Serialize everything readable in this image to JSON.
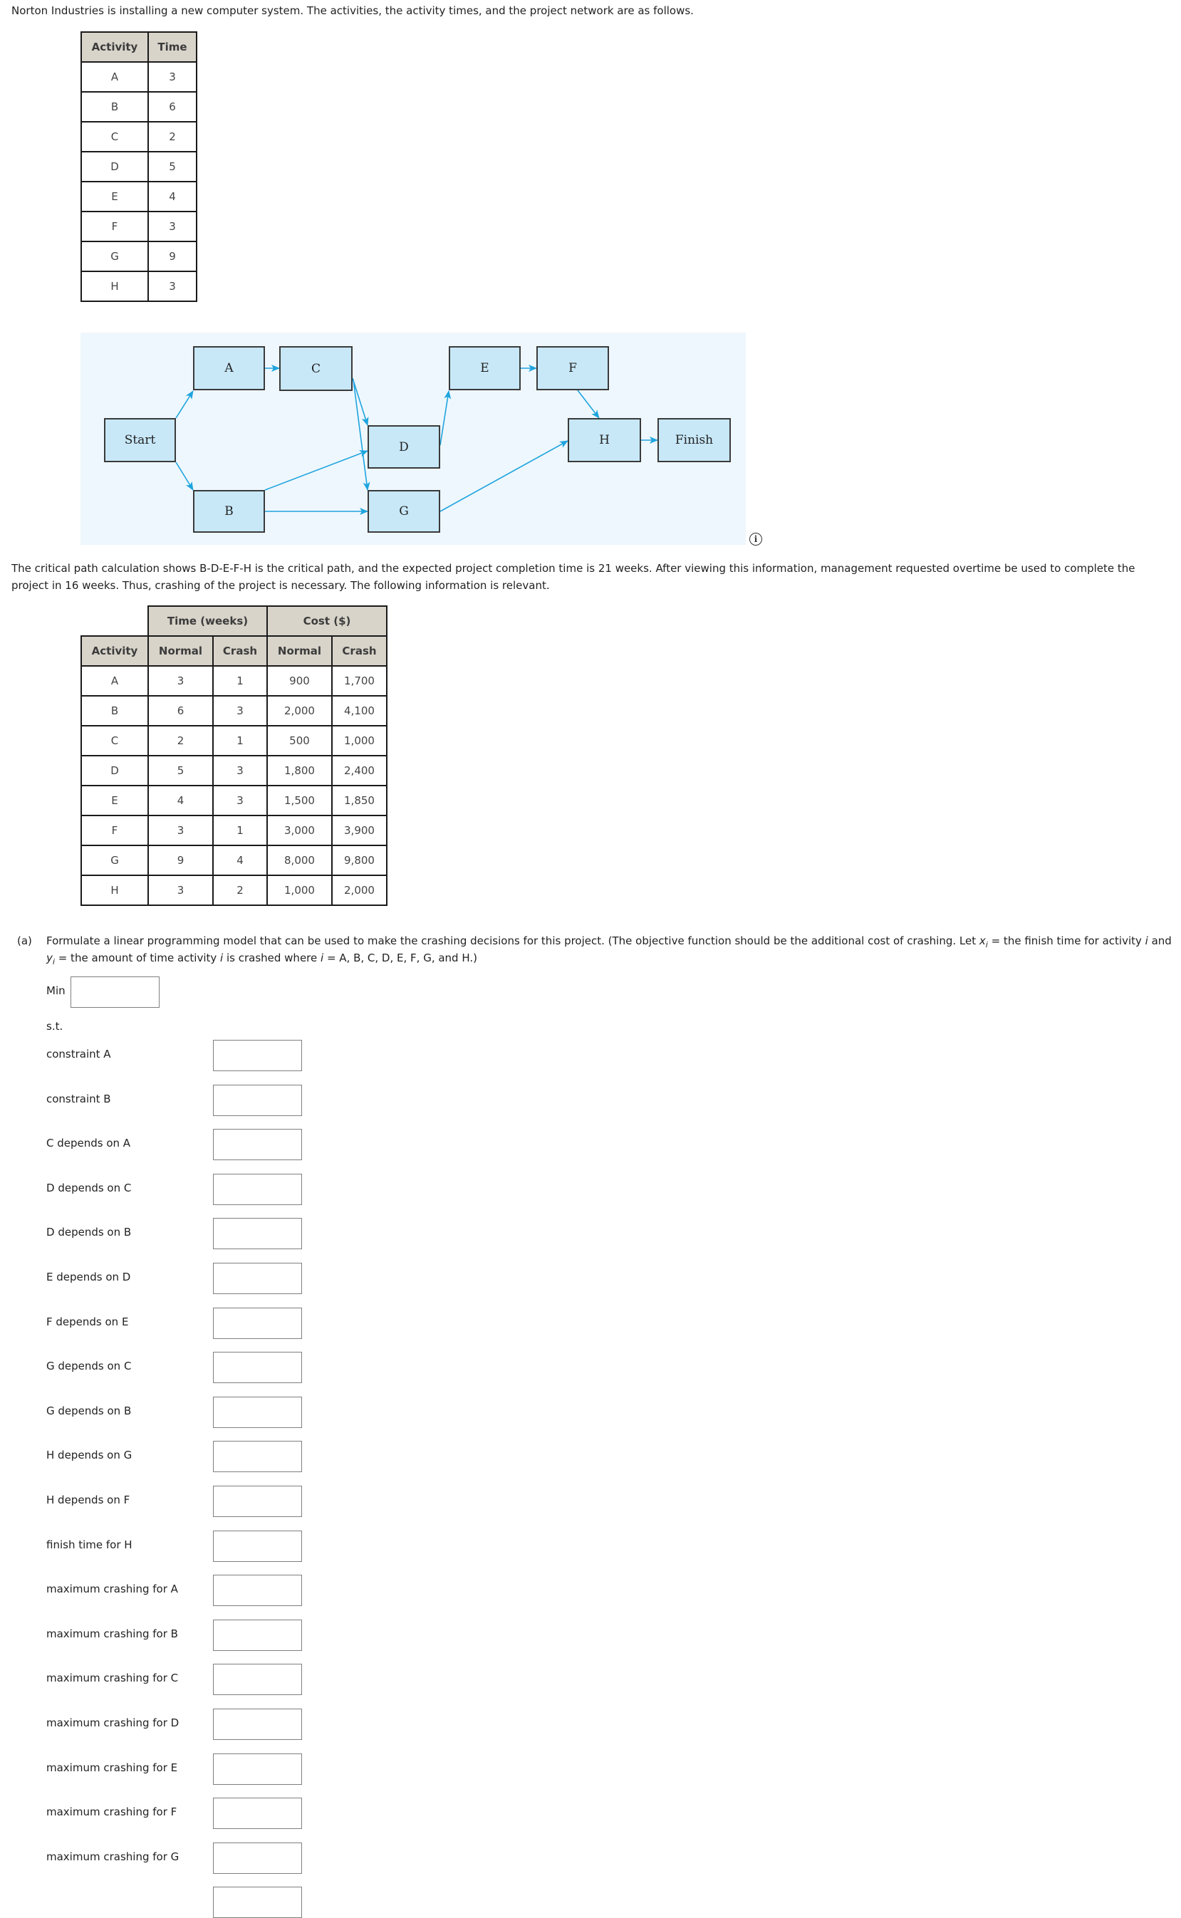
{
  "intro": "Norton Industries is installing a new computer system. The activities, the activity times, and the project network are as follows.",
  "activity_table": {
    "headers": [
      "Activity",
      "Time"
    ],
    "rows": [
      [
        "A",
        "3"
      ],
      [
        "B",
        "6"
      ],
      [
        "C",
        "2"
      ],
      [
        "D",
        "5"
      ],
      [
        "E",
        "4"
      ],
      [
        "F",
        "3"
      ],
      [
        "G",
        "9"
      ],
      [
        "H",
        "3"
      ]
    ]
  },
  "network": {
    "nodes": {
      "start": "Start",
      "a": "A",
      "b": "B",
      "c": "C",
      "d": "D",
      "e": "E",
      "f": "F",
      "g": "G",
      "h": "H",
      "finish": "Finish"
    },
    "edges": [
      [
        "Start",
        "A"
      ],
      [
        "Start",
        "B"
      ],
      [
        "A",
        "C"
      ],
      [
        "C",
        "D"
      ],
      [
        "C",
        "G"
      ],
      [
        "B",
        "D"
      ],
      [
        "B",
        "G"
      ],
      [
        "D",
        "E"
      ],
      [
        "E",
        "F"
      ],
      [
        "F",
        "H"
      ],
      [
        "G",
        "H"
      ],
      [
        "H",
        "Finish"
      ]
    ],
    "colors": {
      "arrow": "#1ea4de",
      "node_fill": "#c8e8f8",
      "background": "#eef7fd"
    },
    "info_icon": "i"
  },
  "critical_path_text": "The critical path calculation shows B-D-E-F-H is the critical path, and the expected project completion time is 21 weeks. After viewing this information, management requested overtime be used to complete the project in 16 weeks. Thus, crashing of the project is necessary. The following information is relevant.",
  "crash_table": {
    "group_headers": [
      "Time (weeks)",
      "Cost ($)"
    ],
    "headers": [
      "Activity",
      "Normal",
      "Crash",
      "Normal",
      "Crash"
    ],
    "rows": [
      [
        "A",
        "3",
        "1",
        "900",
        "1,700"
      ],
      [
        "B",
        "6",
        "3",
        "2,000",
        "4,100"
      ],
      [
        "C",
        "2",
        "1",
        "500",
        "1,000"
      ],
      [
        "D",
        "5",
        "3",
        "1,800",
        "2,400"
      ],
      [
        "E",
        "4",
        "3",
        "1,500",
        "1,850"
      ],
      [
        "F",
        "3",
        "1",
        "3,000",
        "3,900"
      ],
      [
        "G",
        "9",
        "4",
        "8,000",
        "9,800"
      ],
      [
        "H",
        "3",
        "2",
        "1,000",
        "2,000"
      ]
    ]
  },
  "question": {
    "label": "(a)",
    "text_1": "Formulate a linear programming model that can be used to make the crashing decisions for this project. (The objective function should be the additional cost of crashing. Let ",
    "x_var": "x",
    "sub_i": "i",
    "text_2": " = the finish time for activity ",
    "i_var": "i",
    "text_3": " and ",
    "y_var": "y",
    "text_4": " = the amount of time activity ",
    "text_5": " is crashed where ",
    "text_6": " = A, B, C, D, E, F, G, and H.)"
  },
  "model": {
    "min_label": "Min",
    "min_value": "",
    "st_label": "s.t.",
    "constraints": [
      {
        "label": "constraint A",
        "value": ""
      },
      {
        "label": "constraint B",
        "value": ""
      },
      {
        "label": "C depends on A",
        "value": ""
      },
      {
        "label": "D depends on C",
        "value": ""
      },
      {
        "label": "D depends on B",
        "value": ""
      },
      {
        "label": "E depends on D",
        "value": ""
      },
      {
        "label": "F depends on E",
        "value": ""
      },
      {
        "label": "G depends on C",
        "value": ""
      },
      {
        "label": "G depends on B",
        "value": ""
      },
      {
        "label": "H depends on G",
        "value": ""
      },
      {
        "label": "H depends on F",
        "value": ""
      },
      {
        "label": "finish time for H",
        "value": ""
      },
      {
        "label": "maximum crashing for A",
        "value": ""
      },
      {
        "label": "maximum crashing for B",
        "value": ""
      },
      {
        "label": "maximum crashing for C",
        "value": ""
      },
      {
        "label": "maximum crashing for D",
        "value": ""
      },
      {
        "label": "maximum crashing for E",
        "value": ""
      },
      {
        "label": "maximum crashing for F",
        "value": ""
      },
      {
        "label": "maximum crashing for G",
        "value": ""
      },
      {
        "label": "",
        "value": ""
      }
    ]
  }
}
